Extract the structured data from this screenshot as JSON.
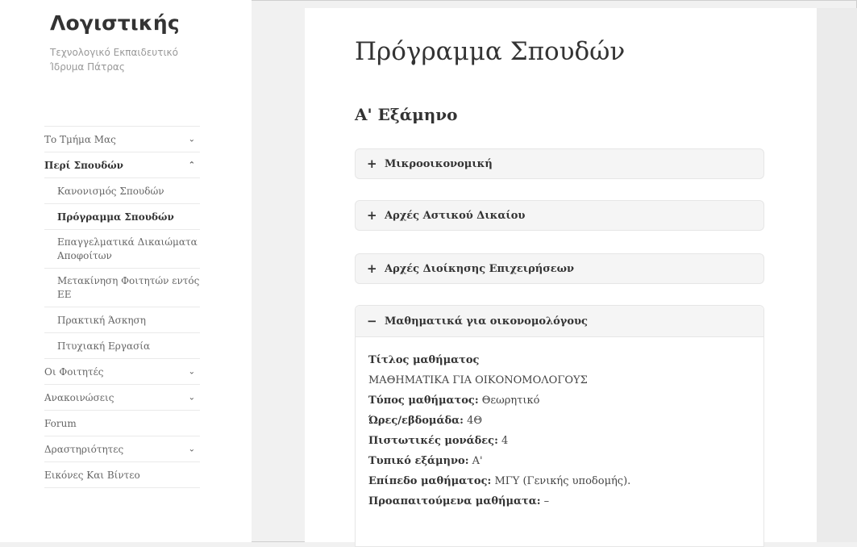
{
  "site": {
    "title": "Λογιστικής",
    "description": "Τεχνολογικό Εκπαιδευτικό Ίδρυμα Πάτρας"
  },
  "nav": [
    {
      "label": "Το Τμήμα Μας",
      "chevron": "⌄"
    },
    {
      "label": "Περί Σπουδών",
      "chevron": "⌃"
    },
    {
      "label": "Κανονισμός Σπουδών"
    },
    {
      "label": "Πρόγραμμα Σπουδών"
    },
    {
      "label": "Επαγγελματικά Δικαιώματα Αποφοίτων"
    },
    {
      "label": "Μετακίνηση Φοιτητών εντός ΕΕ"
    },
    {
      "label": "Πρακτική Άσκηση"
    },
    {
      "label": "Πτυχιακή Εργασία"
    },
    {
      "label": "Οι Φοιτητές",
      "chevron": "⌄"
    },
    {
      "label": "Ανακοινώσεις",
      "chevron": "⌄"
    },
    {
      "label": "Forum"
    },
    {
      "label": "Δραστηριότητες",
      "chevron": "⌄"
    },
    {
      "label": "Εικόνες Και Βίντεο"
    }
  ],
  "page": {
    "title": "Πρόγραμμα Σπουδών",
    "semester": "Α' Εξάμηνο"
  },
  "accordion": [
    {
      "symbol": "+",
      "label": "Μικροοικονομική"
    },
    {
      "symbol": "+",
      "label": "Αρχές Αστικού Δικαίου"
    },
    {
      "symbol": "+",
      "label": "Αρχές Διοίκησης Επιχειρήσεων"
    }
  ],
  "open_course": {
    "symbol": "−",
    "label": "Μαθηματικά για οικονομολόγους",
    "title_label": "Τίτλος μαθήματος",
    "title_value": "ΜΑΘΗΜΑΤΙΚΑ ΓΙΑ ΟΙΚΟΝΟΜΟΛΟΓΟΥΣ",
    "type_label": "Τύπος μαθήματος:",
    "type_value": "Θεωρητικό",
    "hours_label": "Ώρες/εβδομάδα:",
    "hours_value": "4Θ",
    "credits_label": "Πιστωτικές μονάδες:",
    "credits_value": "4",
    "semester_label": "Τυπικό εξάμηνο:",
    "semester_value": "Α'",
    "level_label": "Επίπεδο μαθήματος:",
    "level_value": "ΜΓΥ (Γενικής υποδομής).",
    "prereq_label": "Προαπαιτούμενα μαθήματα:",
    "prereq_value": "–"
  }
}
